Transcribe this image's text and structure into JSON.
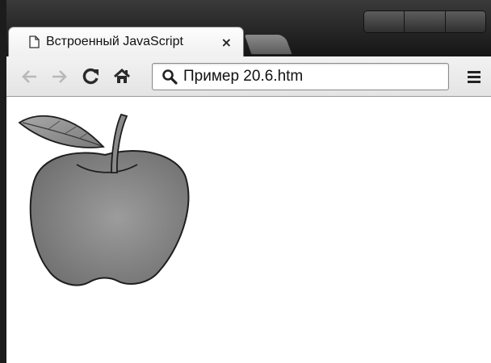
{
  "browser": {
    "tab": {
      "title": "Встроенный JavaScript",
      "close_glyph": "×",
      "icon": "document-icon"
    },
    "toolbar": {
      "back_icon": "back-arrow-icon",
      "forward_icon": "forward-arrow-icon",
      "reload_icon": "reload-icon",
      "home_icon": "home-icon",
      "menu_icon": "menu-icon"
    },
    "address_bar": {
      "value": "Пример 20.6.htm",
      "icon": "search-icon"
    }
  },
  "page": {
    "image": "apple-drawing"
  }
}
